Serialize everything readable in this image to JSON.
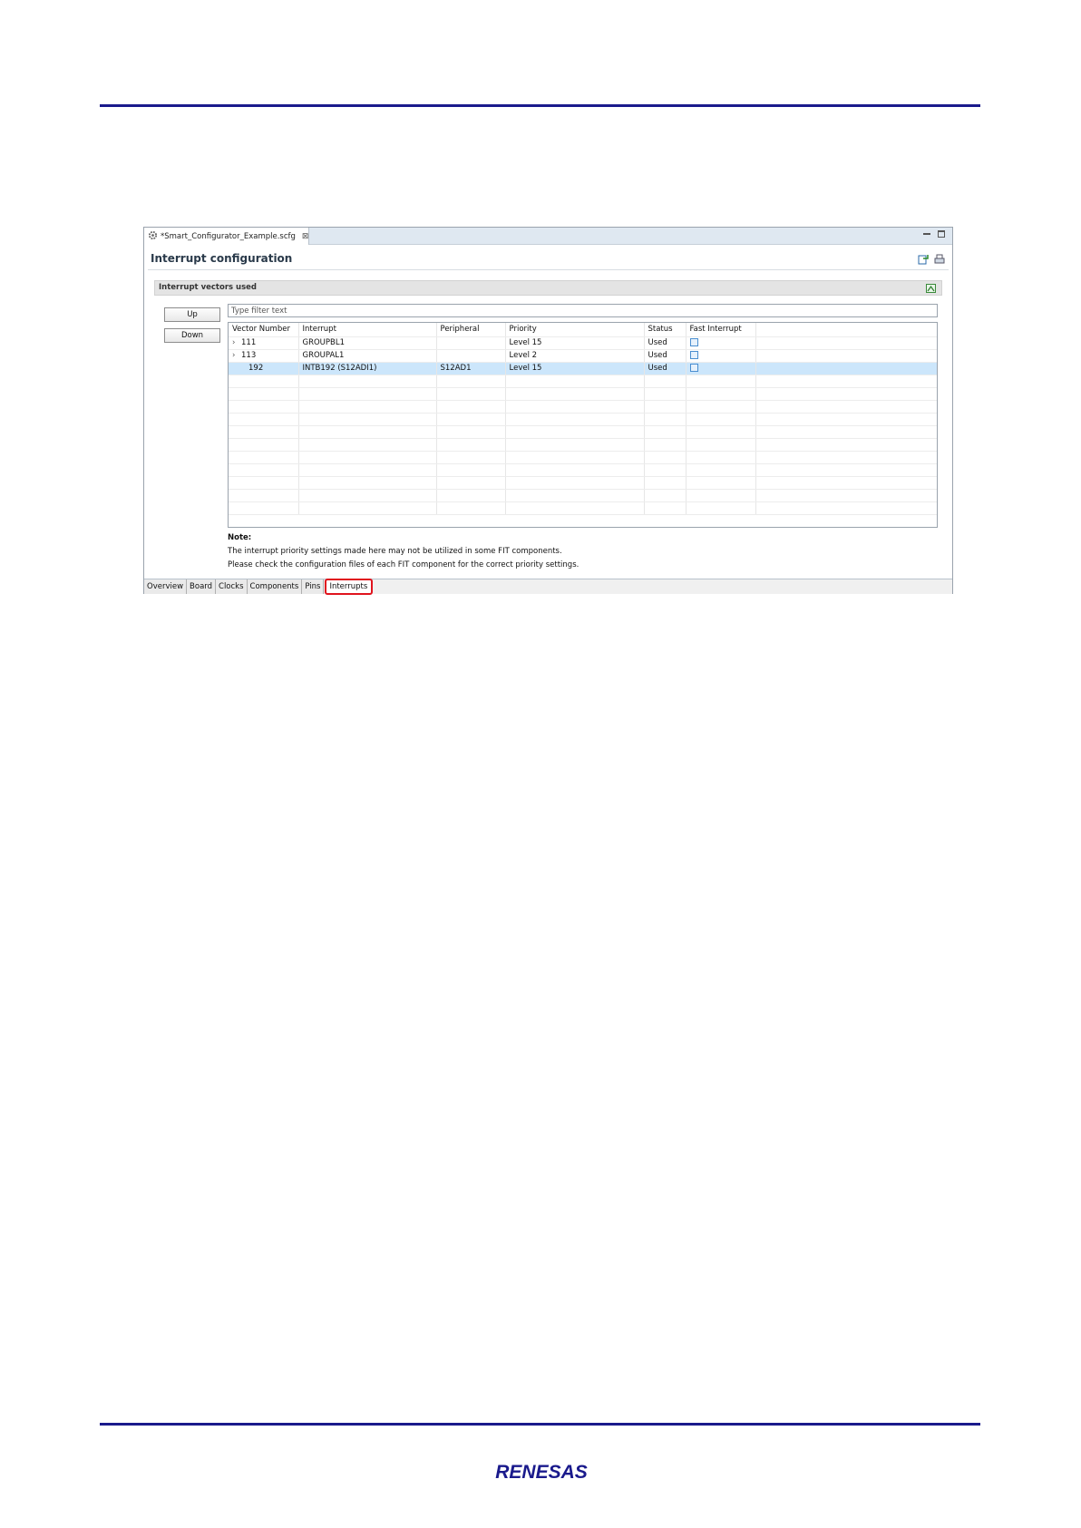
{
  "window": {
    "tab_title": "*Smart_Configurator_Example.scfg",
    "page_title": "Interrupt configuration",
    "section_title": "Interrupt vectors used"
  },
  "buttons": {
    "up": "Up",
    "down": "Down"
  },
  "filter": {
    "placeholder": "Type filter text",
    "value": ""
  },
  "table": {
    "columns": [
      "Vector Number",
      "Interrupt",
      "Peripheral",
      "Priority",
      "Status",
      "Fast Interrupt"
    ],
    "rows": [
      {
        "vector": "111",
        "interrupt": "GROUPBL1",
        "peripheral": "",
        "priority": "Level 15",
        "status": "Used",
        "expandable": true,
        "selected": false
      },
      {
        "vector": "113",
        "interrupt": "GROUPAL1",
        "peripheral": "",
        "priority": "Level 2",
        "status": "Used",
        "expandable": true,
        "selected": false
      },
      {
        "vector": "192",
        "interrupt": "INTB192 (S12ADI1)",
        "peripheral": "S12AD1",
        "priority": "Level 15",
        "status": "Used",
        "expandable": false,
        "selected": true
      }
    ]
  },
  "note": {
    "heading": "Note:",
    "line1": "The interrupt priority settings made here may not be utilized in some FIT components.",
    "line2": "Please check the configuration files of each FIT component for the correct priority settings."
  },
  "bottom_tabs": [
    "Overview",
    "Board",
    "Clocks",
    "Components",
    "Pins",
    "Interrupts"
  ],
  "active_tab": "Interrupts",
  "colors": {
    "rule": "#1a1a8c",
    "highlight": "#e0141e",
    "selected_row": "#cce6fb",
    "logo": "#1a1a8c"
  },
  "logo": {
    "text": "RENESAS"
  }
}
